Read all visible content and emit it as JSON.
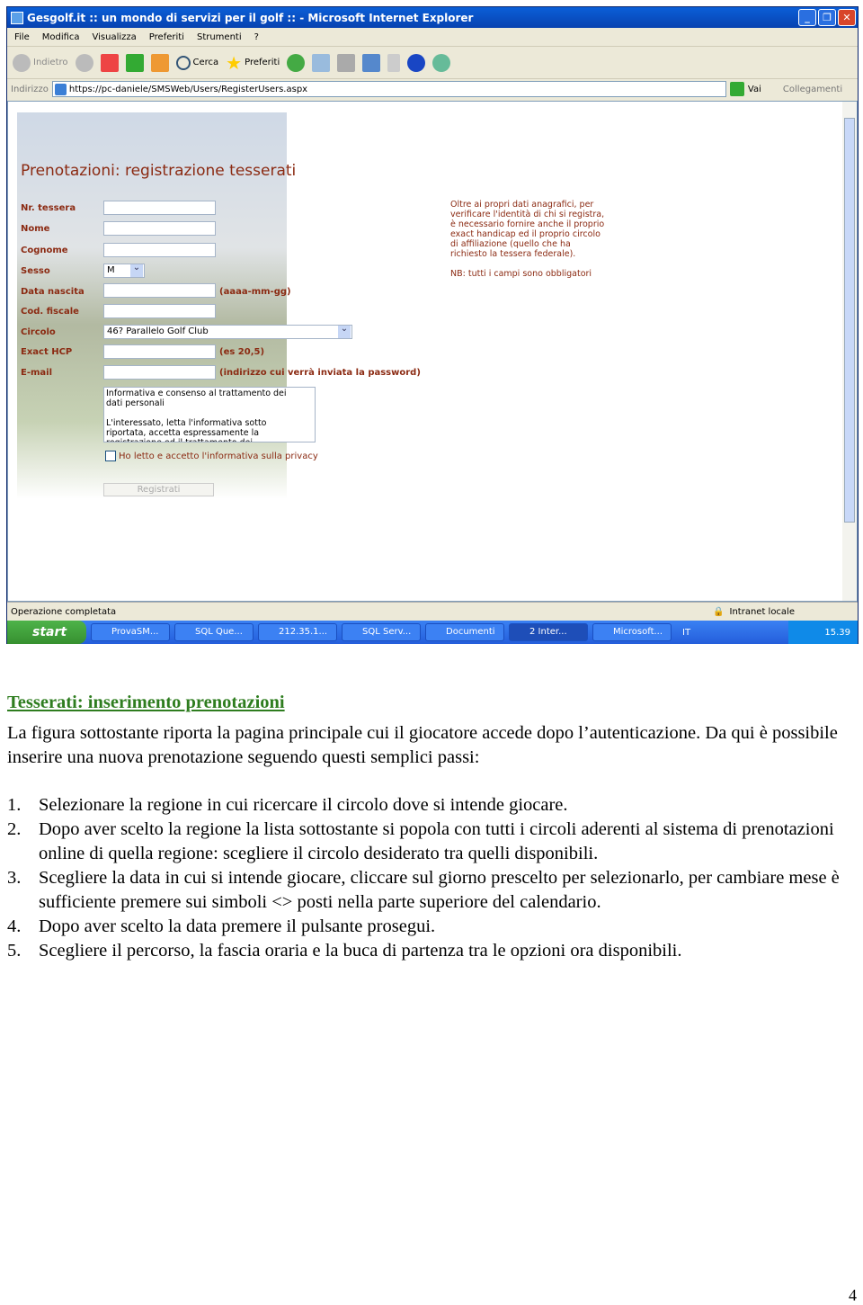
{
  "browser": {
    "title": "Gesgolf.it :: un mondo di servizi per il golf :: - Microsoft Internet Explorer",
    "menu": [
      "File",
      "Modifica",
      "Visualizza",
      "Preferiti",
      "Strumenti",
      "?"
    ],
    "toolbar": {
      "back": "Indietro",
      "search": "Cerca",
      "favorites": "Preferiti"
    },
    "address_label": "Indirizzo",
    "url": "https://pc-daniele/SMSWeb/Users/RegisterUsers.aspx",
    "go": "Vai",
    "links": "Collegamenti",
    "status": "Operazione completata",
    "zone": "Intranet locale"
  },
  "form": {
    "title": "Prenotazioni: registrazione tesserati",
    "labels": [
      "Nr. tessera",
      "Nome",
      "Cognome",
      "Sesso",
      "Data nascita",
      "Cod. fiscale",
      "Circolo",
      "Exact HCP",
      "E-mail"
    ],
    "sesso": "M",
    "circolo": "46? Parallelo Golf Club",
    "hint_date": "(aaaa-mm-gg)",
    "hint_hcp": "(es 20,5)",
    "hint_email": "(indirizzo cui verrà inviata la password)",
    "privacy_text": "Informativa e consenso al trattamento dei dati personali\n\nL'interessato, letta l'informativa sotto riportata, accetta espressamente la registrazione ed il trattamento dei",
    "privacy_check": "Ho letto e accetto l'informativa sulla privacy",
    "submit": "Registrati",
    "side_note": "Oltre ai propri dati anagrafici, per verificare l'identità di chi si registra, è necessario fornire anche il proprio exact handicap ed il proprio circolo di affiliazione (quello che ha richiesto la tessera federale).",
    "side_nb": "NB: tutti i campi sono obbligatori"
  },
  "taskbar": {
    "start": "start",
    "items": [
      "ProvaSM...",
      "SQL Que...",
      "212.35.1...",
      "SQL Serv...",
      "Documenti",
      "2 Inter...",
      "Microsoft..."
    ],
    "lang": "IT",
    "clock": "15.39"
  },
  "doc": {
    "heading": "Tesserati: inserimento prenotazioni",
    "intro": "La figura sottostante riporta la pagina principale cui il giocatore accede dopo l’autenticazione. Da qui è possibile inserire una nuova prenotazione seguendo questi semplici passi:",
    "steps": [
      "Selezionare la regione in cui ricercare il circolo dove si intende giocare.",
      "Dopo aver scelto la regione la lista sottostante si popola con tutti i circoli aderenti al sistema di prenotazioni online di quella regione: scegliere il circolo desiderato tra quelli disponibili.",
      "Scegliere la data in cui si intende giocare, cliccare sul giorno prescelto per selezionarlo, per cambiare mese è sufficiente premere sui simboli <> posti nella parte superiore del calendario.",
      "Dopo aver scelto la data premere il pulsante prosegui.",
      "Scegliere il percorso, la fascia oraria e la buca di partenza tra le opzioni ora disponibili."
    ],
    "page_number": "4"
  }
}
